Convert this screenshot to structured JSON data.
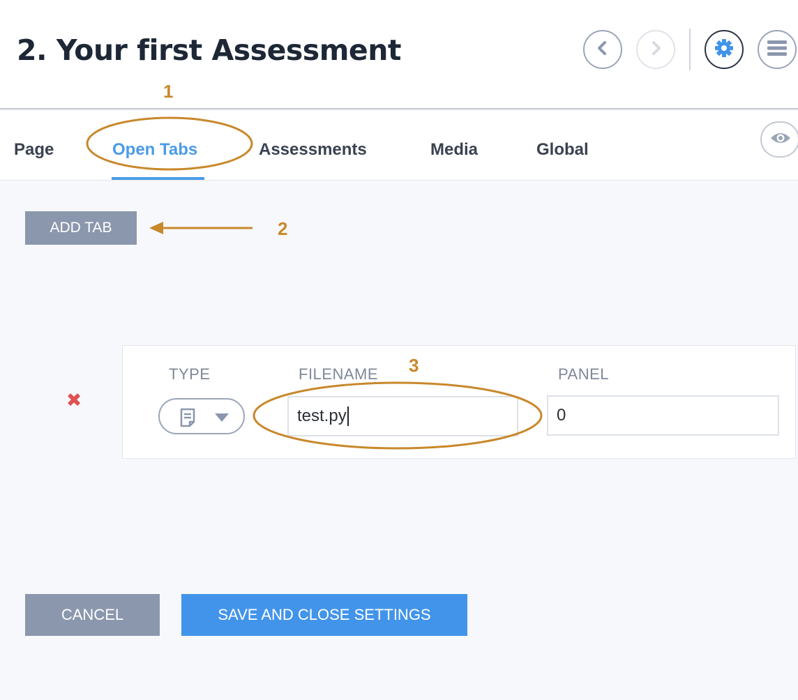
{
  "header": {
    "title": "2. Your first Assessment",
    "buttons": [
      {
        "name": "back-button",
        "icon": "chevron-left-icon",
        "disabled": false
      },
      {
        "name": "forward-button",
        "icon": "chevron-right-icon",
        "disabled": true
      },
      {
        "name": "settings-button",
        "icon": "gear-icon",
        "active": true
      },
      {
        "name": "menu-button",
        "icon": "hamburger-menu-icon"
      }
    ]
  },
  "tabs": {
    "items": [
      {
        "label": "Page",
        "active": false
      },
      {
        "label": "Open Tabs",
        "active": true
      },
      {
        "label": "Assessments",
        "active": false
      },
      {
        "label": "Media",
        "active": false
      },
      {
        "label": "Global",
        "active": false
      }
    ],
    "preview_icon": "eye-icon"
  },
  "actions": {
    "add_tab_label": "ADD TAB",
    "cancel_label": "CANCEL",
    "save_label": "SAVE AND CLOSE SETTINGS"
  },
  "open_tab_row": {
    "delete_symbol": "✖",
    "delete_icon": "delete-x-icon",
    "columns": {
      "type": "TYPE",
      "filename": "FILENAME",
      "panel": "PANEL"
    },
    "type_icon": "file-icon",
    "filename_value": "test.py",
    "panel_value": "0"
  },
  "annotations": {
    "marker_1": "1",
    "marker_2": "2",
    "marker_3": "3"
  },
  "colors": {
    "accent": "#4a9be8",
    "primary_button": "#4294ea",
    "secondary_button": "#8b97ad",
    "annotation": "#c8882b",
    "delete": "#e05050",
    "title_text": "#1d2736"
  }
}
